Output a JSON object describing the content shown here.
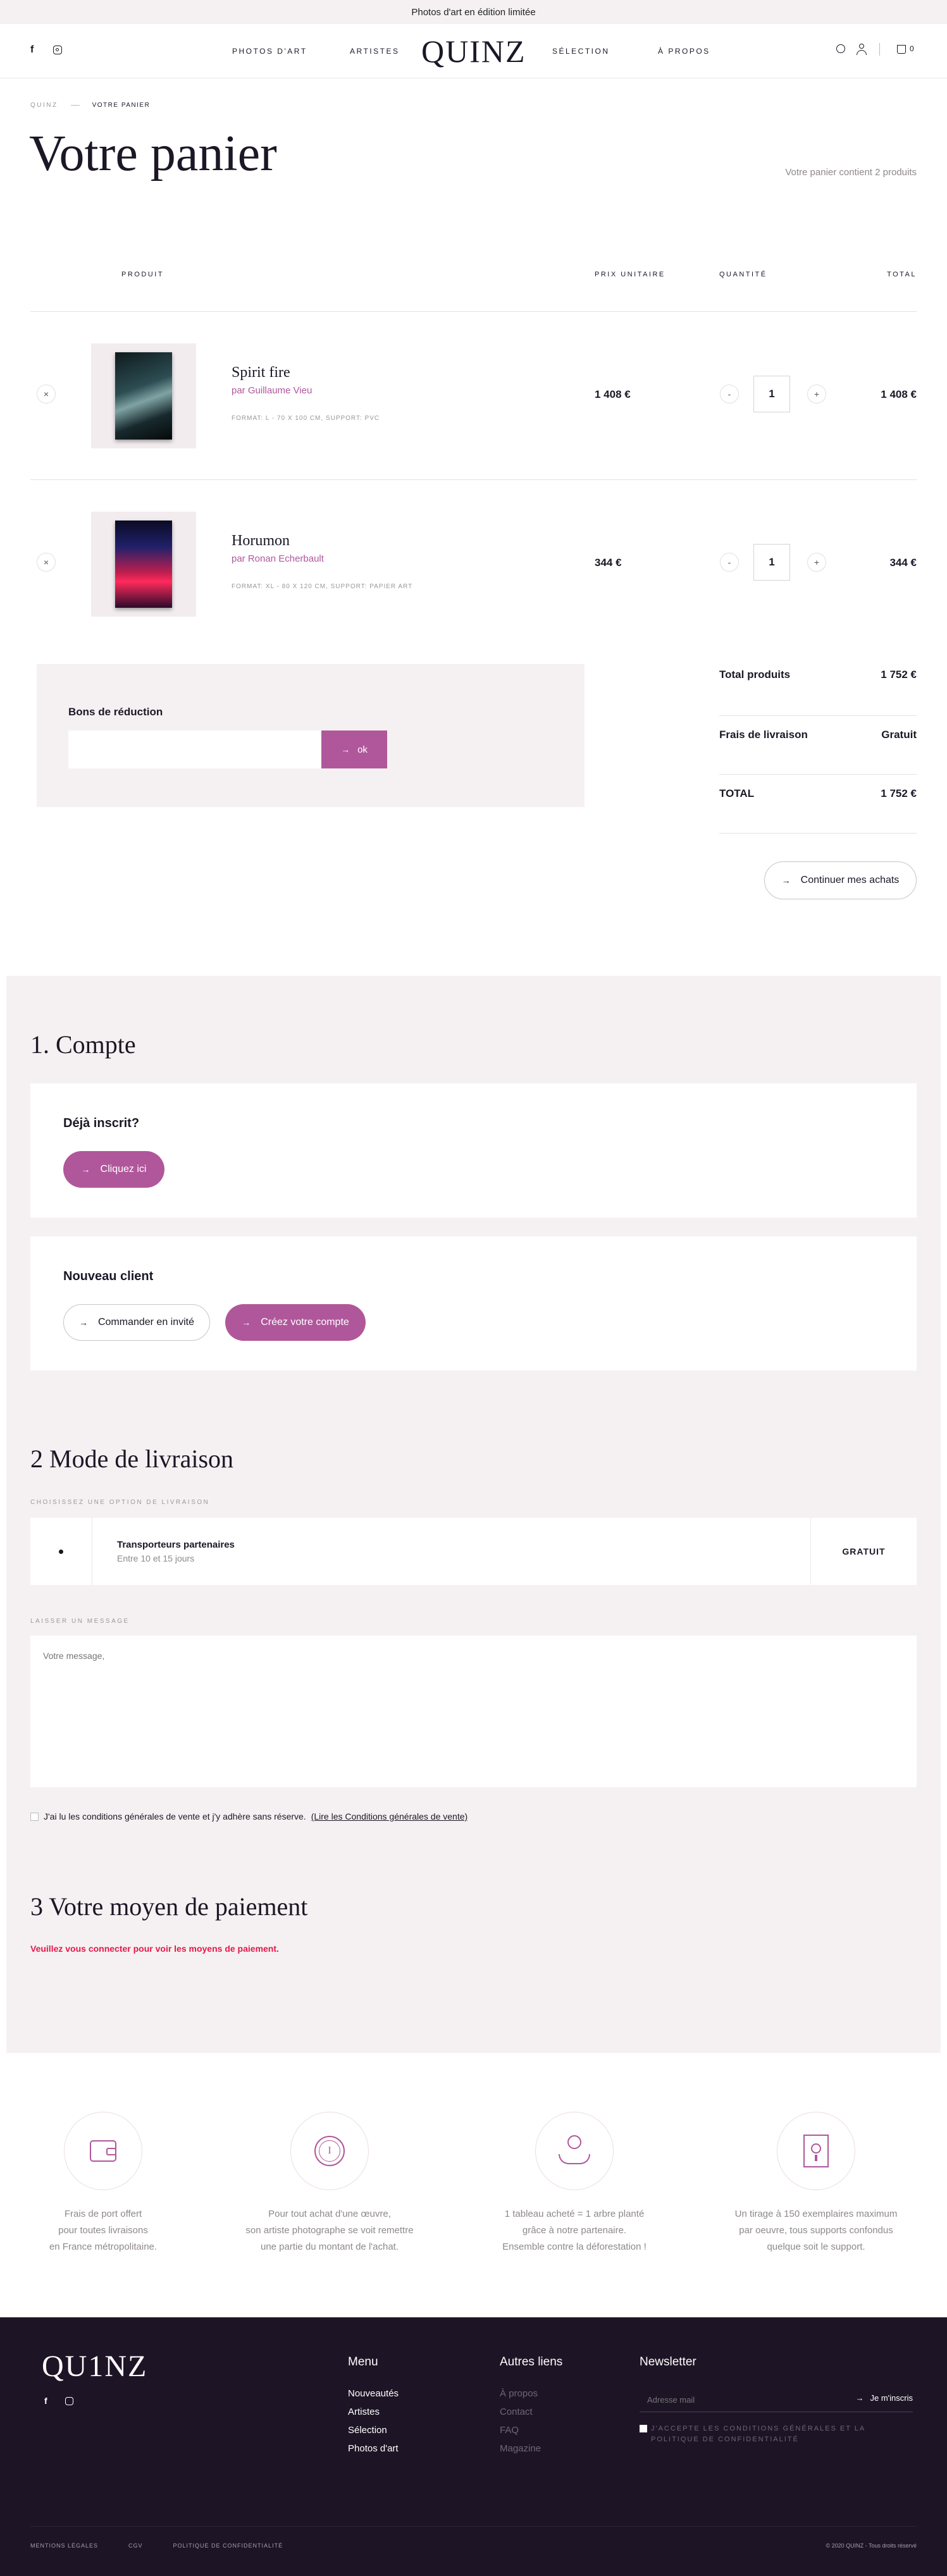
{
  "announcement": "Photos d'art en édition limitée",
  "header": {
    "logo": "QUINZ",
    "nav": [
      "PHOTOS D'ART",
      "ARTISTES",
      "SÉLECTION",
      "À PROPOS"
    ],
    "cart_count": "0"
  },
  "breadcrumb": {
    "home": "QUINZ",
    "current": "VOTRE PANIER"
  },
  "page": {
    "title": "Votre panier",
    "summary": "Votre panier contient 2 produits"
  },
  "cart_table": {
    "headers": {
      "product": "PRODUIT",
      "unit_price": "PRIX UNITAIRE",
      "quantity": "QUANTITÉ",
      "total": "TOTAL"
    },
    "items": [
      {
        "title": "Spirit fire",
        "artist": "par Guillaume Vieu",
        "format": "FORMAT: L - 70 X 100 CM, SUPPORT: PVC",
        "unit_price": "1 408 €",
        "qty": "1",
        "total": "1 408 €"
      },
      {
        "title": "Horumon",
        "artist": "par Ronan Echerbault",
        "format": "FORMAT: XL - 80 X 120 CM, SUPPORT: PAPIER ART",
        "unit_price": "344 €",
        "qty": "1",
        "total": "344 €"
      }
    ],
    "minus": "-",
    "plus": "+",
    "remove": "×"
  },
  "coupon": {
    "title": "Bons de réduction",
    "placeholder": "",
    "button": "ok"
  },
  "totals": {
    "products_label": "Total produits",
    "products_value": "1 752 €",
    "shipping_label": "Frais de livraison",
    "shipping_value": "Gratuit",
    "total_label": "TOTAL",
    "total_value": "1 752 €"
  },
  "continue_button": "Continuer mes achats",
  "checkout": {
    "account_title": "1. Compte",
    "registered_title": "Déjà inscrit?",
    "registered_button": "Cliquez ici",
    "new_title": "Nouveau client",
    "guest_button": "Commander en invité",
    "create_button": "Créez votre compte",
    "delivery_title": "2 Mode de livraison",
    "delivery_hint": "CHOISISSEZ UNE OPTION DE LIVRAISON",
    "carrier_name": "Transporteurs partenaires",
    "carrier_delay": "Entre 10 et 15 jours",
    "carrier_price": "GRATUIT",
    "message_label": "LAISSER UN MESSAGE",
    "message_placeholder": "Votre message,",
    "terms_text": "J'ai lu les conditions générales de vente et j'y adhère sans réserve.",
    "terms_link": "(Lire les Conditions générales de vente)",
    "payment_title": "3 Votre moyen de paiement",
    "payment_warning": "Veuillez vous connecter pour voir les moyens de paiement."
  },
  "features": [
    {
      "icon": "wallet-icon",
      "lines": [
        "Frais de port offert",
        "pour toutes livraisons",
        "en France métropolitaine."
      ]
    },
    {
      "icon": "coin-icon",
      "lines": [
        "Pour tout achat d'une œuvre,",
        "son artiste photographe se voit remettre",
        "une partie du montant de l'achat."
      ]
    },
    {
      "icon": "plant-hand-icon",
      "lines": [
        "1 tableau acheté = 1 arbre planté",
        "grâce à notre partenaire.",
        "Ensemble contre la déforestation !"
      ]
    },
    {
      "icon": "certificate-icon",
      "lines": [
        "Un tirage à 150 exemplaires maximum",
        "par oeuvre, tous supports confondus",
        "quelque soit le support."
      ]
    }
  ],
  "footer": {
    "logo": "QU1NZ",
    "menu_title": "Menu",
    "menu": [
      "Nouveautés",
      "Artistes",
      "Sélection",
      "Photos d'art"
    ],
    "other_title": "Autres liens",
    "other": [
      "À propos",
      "Contact",
      "FAQ",
      "Magazine"
    ],
    "newsletter_title": "Newsletter",
    "newsletter_placeholder": "Adresse mail",
    "newsletter_button": "Je m'inscris",
    "newsletter_consent": "J'ACCEPTE LES CONDITIONS GÉNÉRALES ET LA POLITIQUE DE CONFIDENTIALITÉ",
    "legal": [
      "MENTIONS LÉGALES",
      "CGV",
      "POLITIQUE DE CONFIDENTIALITÉ"
    ],
    "copyright": "© 2020 QUINZ - Tous droits réservé"
  },
  "colors": {
    "accent": "#b0579b",
    "dark": "#1c1726",
    "panel": "#f5f1f2",
    "footer_bg": "#1d1525",
    "error": "#e5174a"
  }
}
